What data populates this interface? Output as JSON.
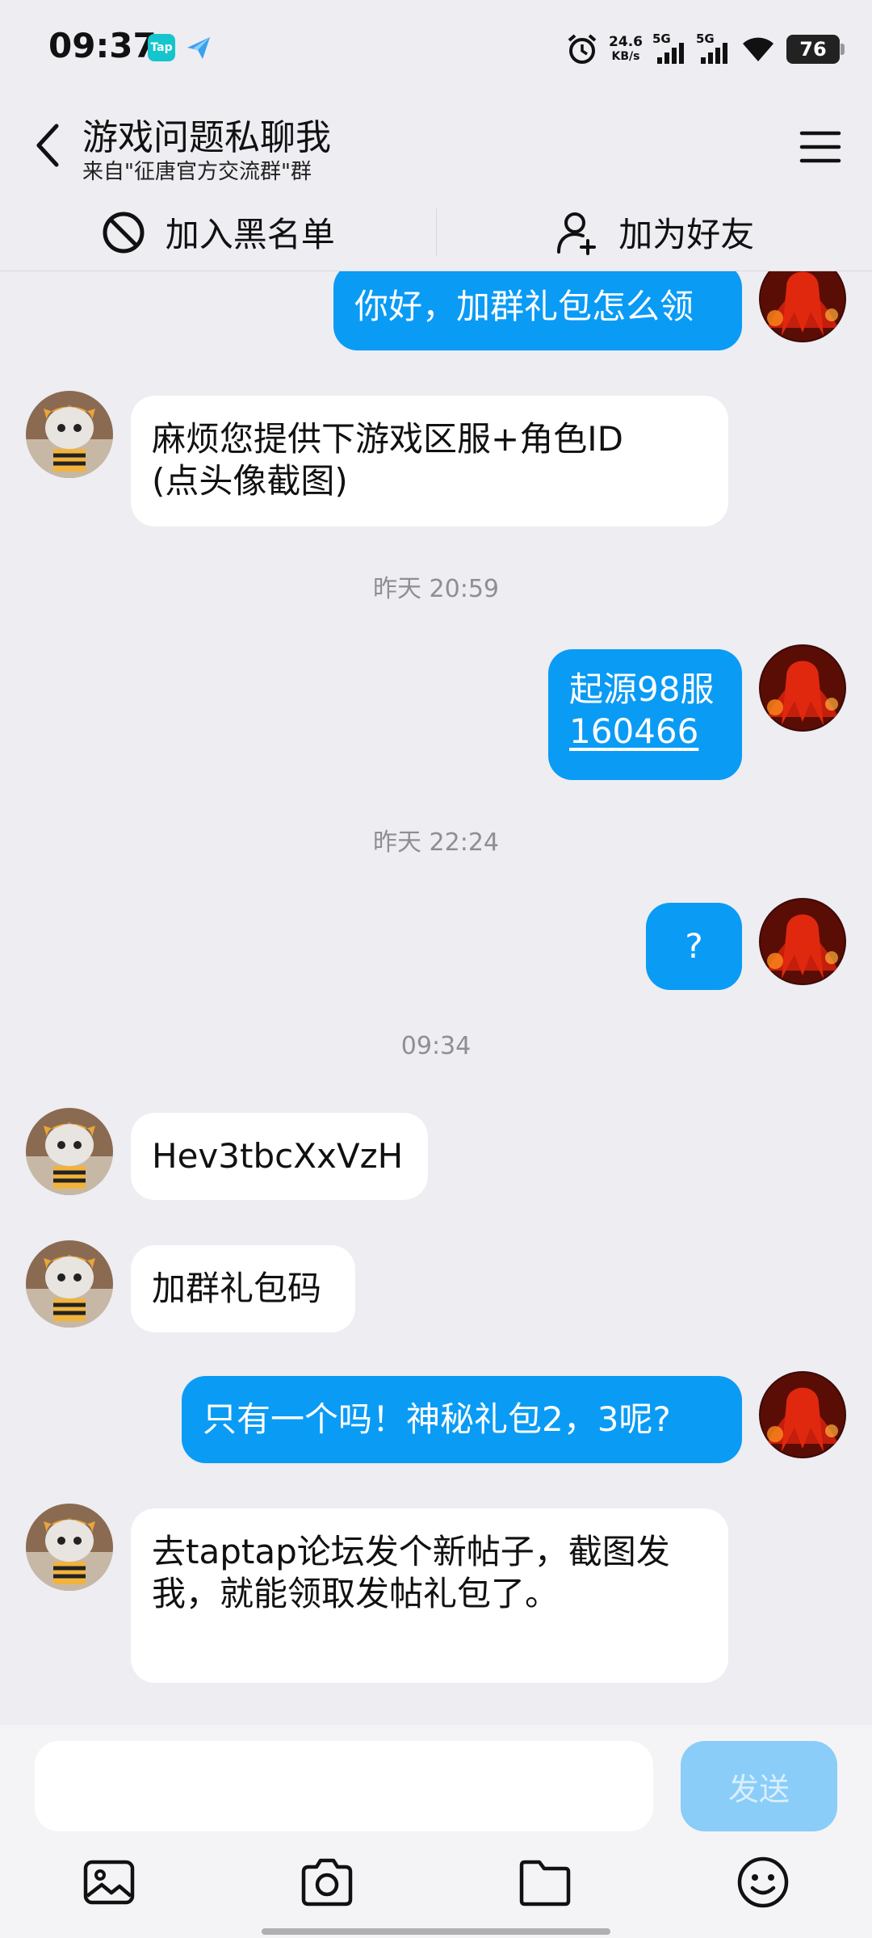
{
  "status_bar": {
    "time": "09:37",
    "app_icons": [
      "tap-icon",
      "paper-plane-icon"
    ],
    "network_speed": "24.6",
    "network_unit": "KB/s",
    "signal_1_label": "5G",
    "signal_2_label": "5G",
    "battery": "76"
  },
  "header": {
    "title": "游戏问题私聊我",
    "subtitle": "来自\"征唐官方交流群\"群"
  },
  "actions": {
    "block": "加入黑名单",
    "add_friend": "加为好友"
  },
  "messages": [
    {
      "side": "out",
      "text": "你好，加群礼包怎么领"
    },
    {
      "side": "in",
      "line1": "麻烦您提供下游戏区服+角色ID",
      "line2": "(点头像截图)"
    },
    {
      "time": "昨天 20:59"
    },
    {
      "side": "out",
      "line1": "起源98服",
      "line2": "160466"
    },
    {
      "time": "昨天 22:24"
    },
    {
      "side": "out",
      "text": "?"
    },
    {
      "time": "09:34"
    },
    {
      "side": "in",
      "text": "Hev3tbcXxVzH"
    },
    {
      "side": "in",
      "text": "加群礼包码"
    },
    {
      "side": "out",
      "text": "只有一个吗！神秘礼包2，3呢?"
    },
    {
      "side": "in",
      "line1": "去taptap论坛发个新帖子，截图发",
      "line2": "我，就能领取发帖礼包了。"
    }
  ],
  "input": {
    "value": "",
    "send_label": "发送"
  },
  "toolbar": [
    "image-icon",
    "camera-icon",
    "folder-icon",
    "emoji-icon"
  ],
  "colors": {
    "outgoing_bubble": "#0A9BF5",
    "incoming_bubble": "#FFFFFF",
    "background": "#EDEDF2",
    "send_button_disabled": "#8ACDF8"
  }
}
